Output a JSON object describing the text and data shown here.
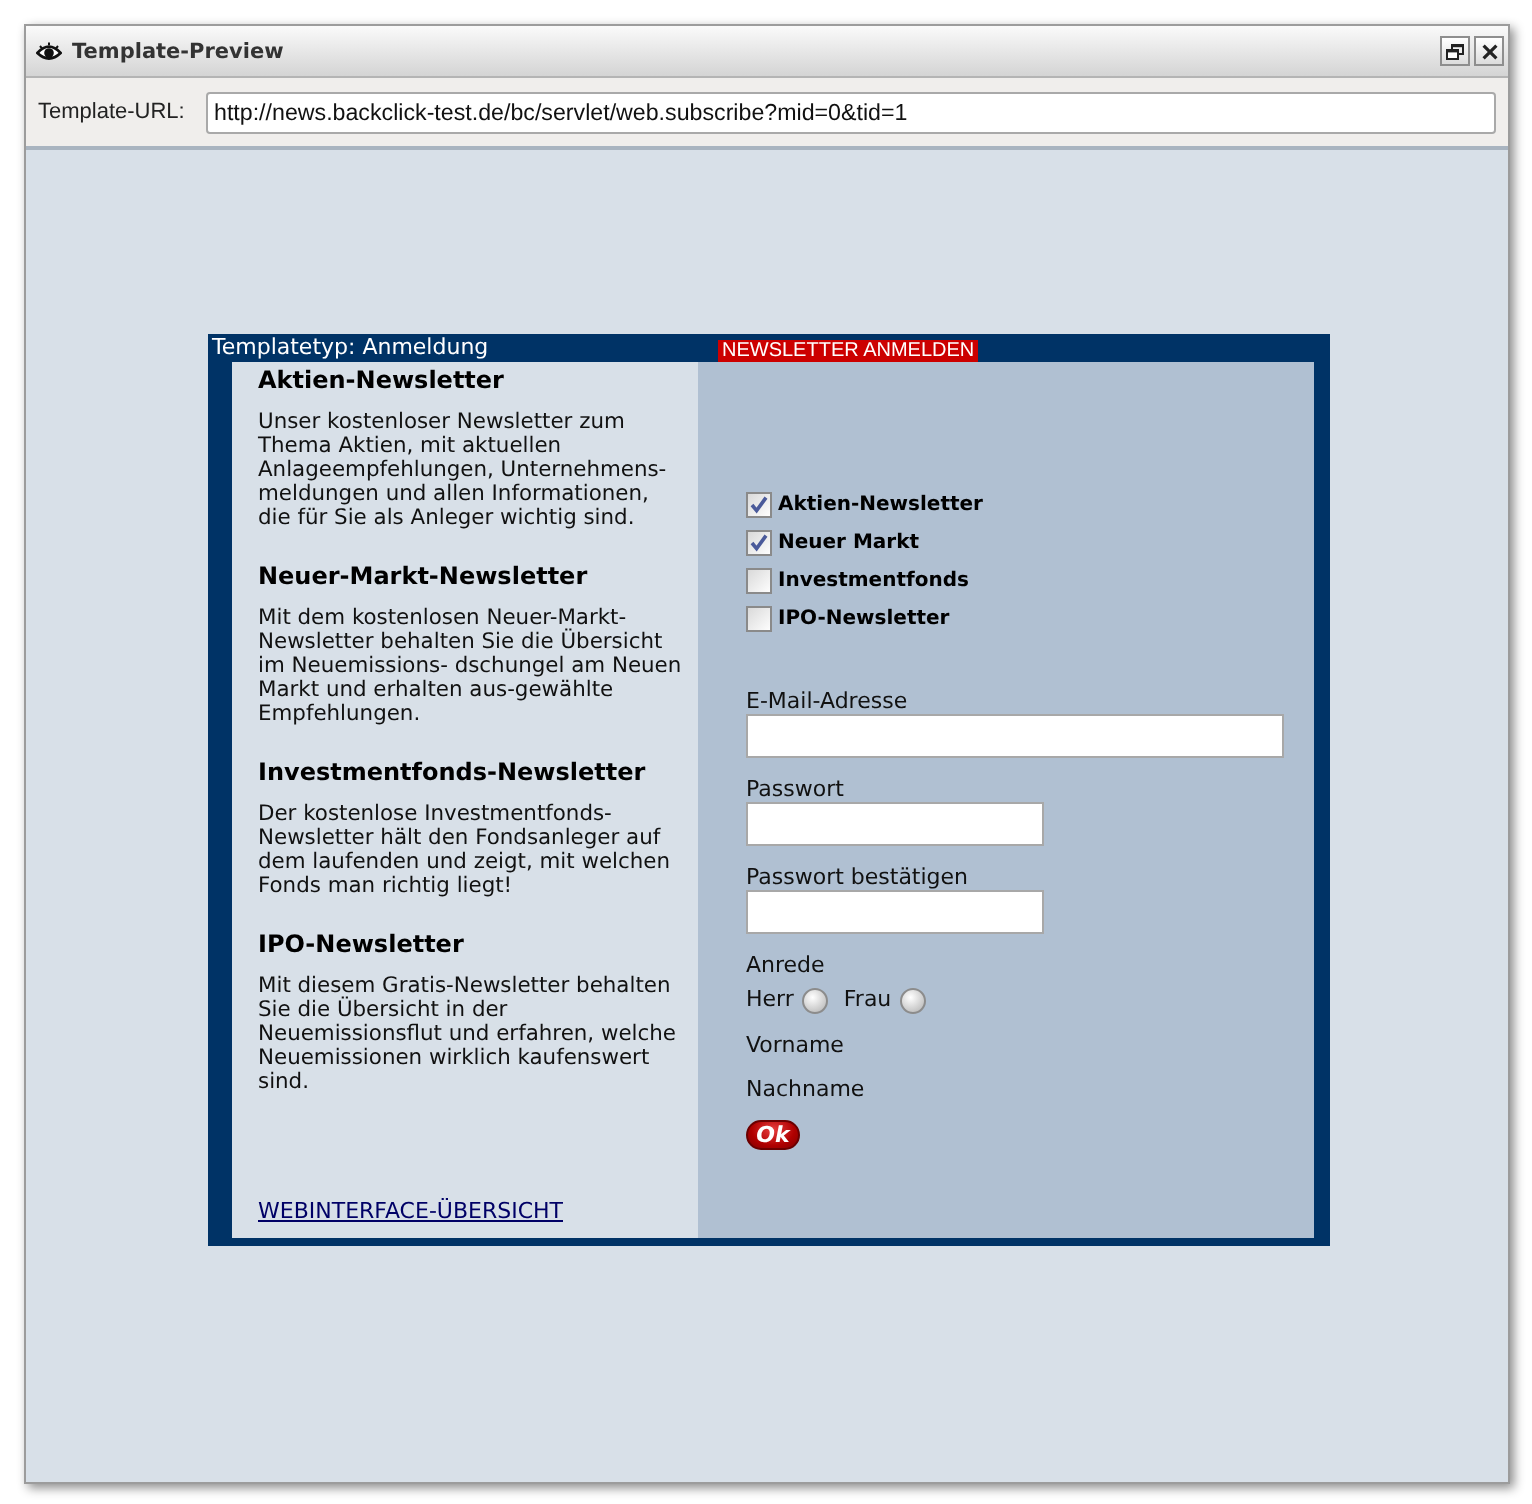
{
  "window": {
    "title": "Template-Preview"
  },
  "url_bar": {
    "label": "Template-URL:",
    "value": "http://news.backclick-test.de/bc/servlet/web.subscribe?mid=0&tid=1"
  },
  "template": {
    "type_label": "Templatetyp: Anmeldung",
    "badge": "NEWSLETTER ANMELDEN",
    "newsletters": [
      {
        "title": "Aktien-Newsletter",
        "description": "Unser kostenloser Newsletter zum Thema Aktien, mit aktuellen Anlageempfehlungen, Unternehmens- meldungen und allen Informationen, die für Sie als Anleger wichtig sind."
      },
      {
        "title": "Neuer-Markt-Newsletter",
        "description": "Mit dem kostenlosen Neuer-Markt-Newsletter behalten Sie die Übersicht im Neuemissions- dschungel am Neuen Markt und erhalten aus-gewählte Empfehlungen."
      },
      {
        "title": "Investmentfonds-Newsletter",
        "description": "Der kostenlose Investmentfonds-Newsletter hält den Fondsanleger auf dem laufenden und zeigt, mit welchen Fonds man richtig liegt!"
      },
      {
        "title": "IPO-Newsletter",
        "description": "Mit diesem Gratis-Newsletter behalten Sie die Übersicht in der Neuemissionsflut und erfahren, welche Neuemissionen wirklich kaufenswert sind."
      }
    ],
    "overview_link": "WEBINTERFACE-ÜBERSICHT",
    "form": {
      "checkboxes": [
        {
          "label": "Aktien-Newsletter",
          "checked": true
        },
        {
          "label": "Neuer Markt",
          "checked": true
        },
        {
          "label": "Investmentfonds",
          "checked": false
        },
        {
          "label": "IPO-Newsletter",
          "checked": false
        }
      ],
      "fields": [
        {
          "kind": "text",
          "label": "E-Mail-Adresse"
        },
        {
          "kind": "password",
          "label": "Passwort"
        },
        {
          "kind": "password",
          "label": "Passwort bestätigen"
        },
        {
          "kind": "radio",
          "label": "Anrede",
          "options": [
            {
              "label": "Herr",
              "selected": false
            },
            {
              "label": "Frau",
              "selected": false
            }
          ]
        },
        {
          "kind": "label",
          "label": "Vorname"
        },
        {
          "kind": "label",
          "label": "Nachname"
        }
      ],
      "submit": "Ok"
    }
  }
}
